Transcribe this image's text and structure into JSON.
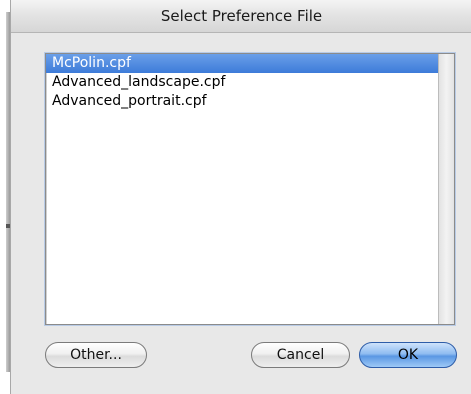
{
  "window": {
    "title": "Select Preference File"
  },
  "files": [
    {
      "name": "McPolin.cpf",
      "selected": true
    },
    {
      "name": "Advanced_landscape.cpf",
      "selected": false
    },
    {
      "name": "Advanced_portrait.cpf",
      "selected": false
    }
  ],
  "buttons": {
    "other": "Other...",
    "cancel": "Cancel",
    "ok": "OK"
  },
  "colors": {
    "selection": "#3d7bd9",
    "default_button": "#5a97e3",
    "dialog_background": "#e8e8e8"
  }
}
